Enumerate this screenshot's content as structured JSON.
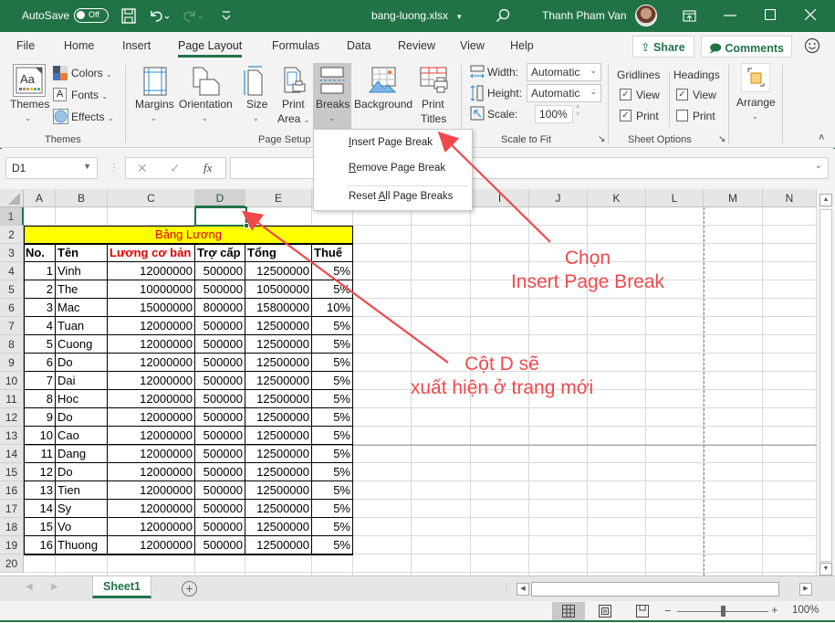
{
  "titlebar": {
    "autosave_label": "AutoSave",
    "autosave_state": "Off",
    "filename": "bang-luong.xlsx",
    "user_name": "Thanh Pham Van",
    "window_controls": [
      "ribbon-display-icon",
      "minimize-icon",
      "maximize-icon",
      "close-icon"
    ]
  },
  "menu": {
    "tabs": [
      "File",
      "Home",
      "Insert",
      "Page Layout",
      "Formulas",
      "Data",
      "Review",
      "View",
      "Help"
    ],
    "active_tab": "Page Layout",
    "share_label": "Share",
    "comments_label": "Comments"
  },
  "ribbon": {
    "themes": {
      "themes_label": "Themes",
      "colors_label": "Colors",
      "fonts_label": "Fonts",
      "effects_label": "Effects",
      "group_label": "Themes"
    },
    "page_setup": {
      "margins_label": "Margins",
      "orientation_label": "Orientation",
      "size_label": "Size",
      "print_area_label_1": "Print",
      "print_area_label_2": "Area",
      "breaks_label": "Breaks",
      "background_label": "Background",
      "print_titles_label_1": "Print",
      "print_titles_label_2": "Titles",
      "group_label": "Page Setup"
    },
    "scale_to_fit": {
      "width_label": "Width:",
      "width_value": "Automatic",
      "height_label": "Height:",
      "height_value": "Automatic",
      "scale_label": "Scale:",
      "scale_value": "100%",
      "group_label": "Scale to Fit"
    },
    "sheet_options": {
      "gridlines_label": "Gridlines",
      "headings_label": "Headings",
      "view_label": "View",
      "print_label": "Print",
      "gridlines_view": true,
      "gridlines_print": true,
      "headings_view": true,
      "headings_print": false,
      "group_label": "Sheet Options"
    },
    "arrange": {
      "arrange_label": "Arrange"
    }
  },
  "breaks_menu": {
    "items": [
      {
        "pre": "",
        "key": "I",
        "post": "nsert Page Break"
      },
      {
        "pre": "",
        "key": "R",
        "post": "emove Page Break"
      },
      {
        "pre": "Reset ",
        "key": "A",
        "post": "ll Page Breaks"
      }
    ]
  },
  "formula_bar": {
    "name_box": "D1",
    "formula": ""
  },
  "sheet": {
    "columns": [
      "A",
      "B",
      "C",
      "D",
      "E",
      "F",
      "G",
      "H",
      "I",
      "J",
      "K",
      "L",
      "M",
      "N"
    ],
    "selected_column": "D",
    "rows": [
      "1",
      "2",
      "3",
      "4",
      "5",
      "6",
      "7",
      "8",
      "9",
      "10",
      "11",
      "12",
      "13",
      "14",
      "15",
      "16",
      "17",
      "18",
      "19",
      "20"
    ],
    "selected_row": "1",
    "title": "Bảng Lương",
    "headers": [
      "No.",
      "Tên",
      "Lương cơ bản",
      "Trợ cấp",
      "Tổng",
      "Thuế"
    ],
    "data": [
      [
        "1",
        "Vinh",
        "12000000",
        "500000",
        "12500000",
        "5%"
      ],
      [
        "2",
        "The",
        "10000000",
        "500000",
        "10500000",
        "5%"
      ],
      [
        "3",
        "Mac",
        "15000000",
        "800000",
        "15800000",
        "10%"
      ],
      [
        "4",
        "Tuan",
        "12000000",
        "500000",
        "12500000",
        "5%"
      ],
      [
        "5",
        "Cuong",
        "12000000",
        "500000",
        "12500000",
        "5%"
      ],
      [
        "6",
        "Do",
        "12000000",
        "500000",
        "12500000",
        "5%"
      ],
      [
        "7",
        "Dai",
        "12000000",
        "500000",
        "12500000",
        "5%"
      ],
      [
        "8",
        "Hoc",
        "12000000",
        "500000",
        "12500000",
        "5%"
      ],
      [
        "9",
        "Do",
        "12000000",
        "500000",
        "12500000",
        "5%"
      ],
      [
        "10",
        "Cao",
        "12000000",
        "500000",
        "12500000",
        "5%"
      ],
      [
        "11",
        "Dang",
        "12000000",
        "500000",
        "12500000",
        "5%"
      ],
      [
        "12",
        "Do",
        "12000000",
        "500000",
        "12500000",
        "5%"
      ],
      [
        "13",
        "Tien",
        "12000000",
        "500000",
        "12500000",
        "5%"
      ],
      [
        "14",
        "Sy",
        "12000000",
        "500000",
        "12500000",
        "5%"
      ],
      [
        "15",
        "Vo",
        "12000000",
        "500000",
        "12500000",
        "5%"
      ],
      [
        "16",
        "Thuong",
        "12000000",
        "500000",
        "12500000",
        "5%"
      ]
    ],
    "sheet_tabs": [
      "Sheet1"
    ],
    "active_sheet": "Sheet1"
  },
  "statusbar": {
    "zoom": "100%",
    "zoom_slider_value_percent": 100
  },
  "annotations": {
    "callout_1_line1": "Chọn",
    "callout_1_line2": "Insert Page Break",
    "callout_2_line1": "Cột D sẽ",
    "callout_2_line2": "xuất hiện ở trang mới",
    "color": "#f0494c"
  },
  "colors": {
    "brand": "#217346",
    "title_band_fill": "#ffff00",
    "title_text": "#e00000"
  }
}
